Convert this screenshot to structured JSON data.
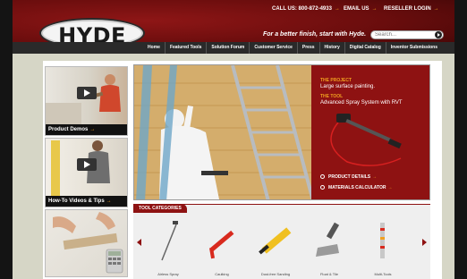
{
  "header": {
    "logo_text": "HYDE",
    "call_us": "CALL US: 800-872-4933",
    "email_us": "EMAIL US",
    "reseller_login": "RESELLER LOGIN",
    "arrow": "→",
    "tagline": "For a better finish, start with Hyde.",
    "search": {
      "placeholder": "Search..."
    }
  },
  "nav": {
    "items": [
      "Home",
      "Featured Tools",
      "Solution Forum",
      "Customer Service",
      "Press",
      "History",
      "Digital Catalog",
      "Inventor Submissions"
    ]
  },
  "sidebar": {
    "thumbs": [
      {
        "label": "Product Demos"
      },
      {
        "label": "How-To Videos & Tips"
      },
      {
        "label": ""
      }
    ]
  },
  "hero": {
    "project_label": "THE PROJECT",
    "project_value": "Large surface painting.",
    "tool_label": "THE TOOL",
    "tool_value": "Advanced Spray System with RVT",
    "links": [
      "PRODUCT DETAILS",
      "MATERIALS CALCULATOR"
    ]
  },
  "tools": {
    "title": "TOOL CATEGORIES",
    "items": [
      "Airless Spray",
      "Caulking",
      "Dust-free Sanding",
      "Float & Tile",
      "Multi-Tools"
    ]
  },
  "colors": {
    "brand_red": "#8e1212",
    "accent_orange": "#f0a020",
    "nav_dark": "#2a2a2a"
  }
}
